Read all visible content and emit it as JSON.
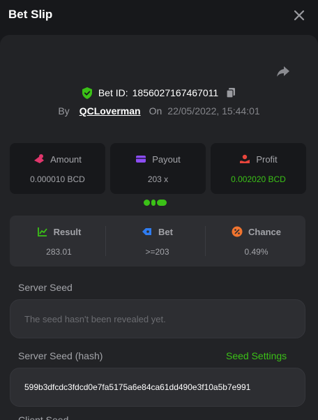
{
  "header": {
    "title": "Bet Slip"
  },
  "bet": {
    "id_label": "Bet ID:",
    "id_value": "1856027167467011",
    "by_label": "By",
    "user": "QCLoverman",
    "on_label": "On",
    "date": "22/05/2022, 15:44:01"
  },
  "stats": {
    "amount": {
      "label": "Amount",
      "value": "0.000010 BCD"
    },
    "payout": {
      "label": "Payout",
      "value": "203 x"
    },
    "profit": {
      "label": "Profit",
      "value": "0.002020 BCD"
    }
  },
  "results": {
    "result": {
      "label": "Result",
      "value": "283.01"
    },
    "bet": {
      "label": "Bet",
      "value": ">=203"
    },
    "chance": {
      "label": "Chance",
      "value": "0.49%"
    }
  },
  "server_seed": {
    "label": "Server Seed",
    "placeholder": "The seed hasn't been revealed yet."
  },
  "server_seed_hash": {
    "label": "Server Seed (hash)",
    "settings_link": "Seed Settings",
    "value": "599b3dfcdc3fdcd0e7fa5175a6e84ca61dd490e3f10a5b7e991"
  },
  "client_seed": {
    "label": "Client Seed"
  },
  "colors": {
    "accent_green": "#3bc117",
    "amount_icon": "#e0366c",
    "payout_icon": "#8c4df2",
    "profit_icon": "#e8453c",
    "result_icon": "#3bc117",
    "bet_icon": "#2f7cf0",
    "chance_icon": "#f0742f"
  }
}
